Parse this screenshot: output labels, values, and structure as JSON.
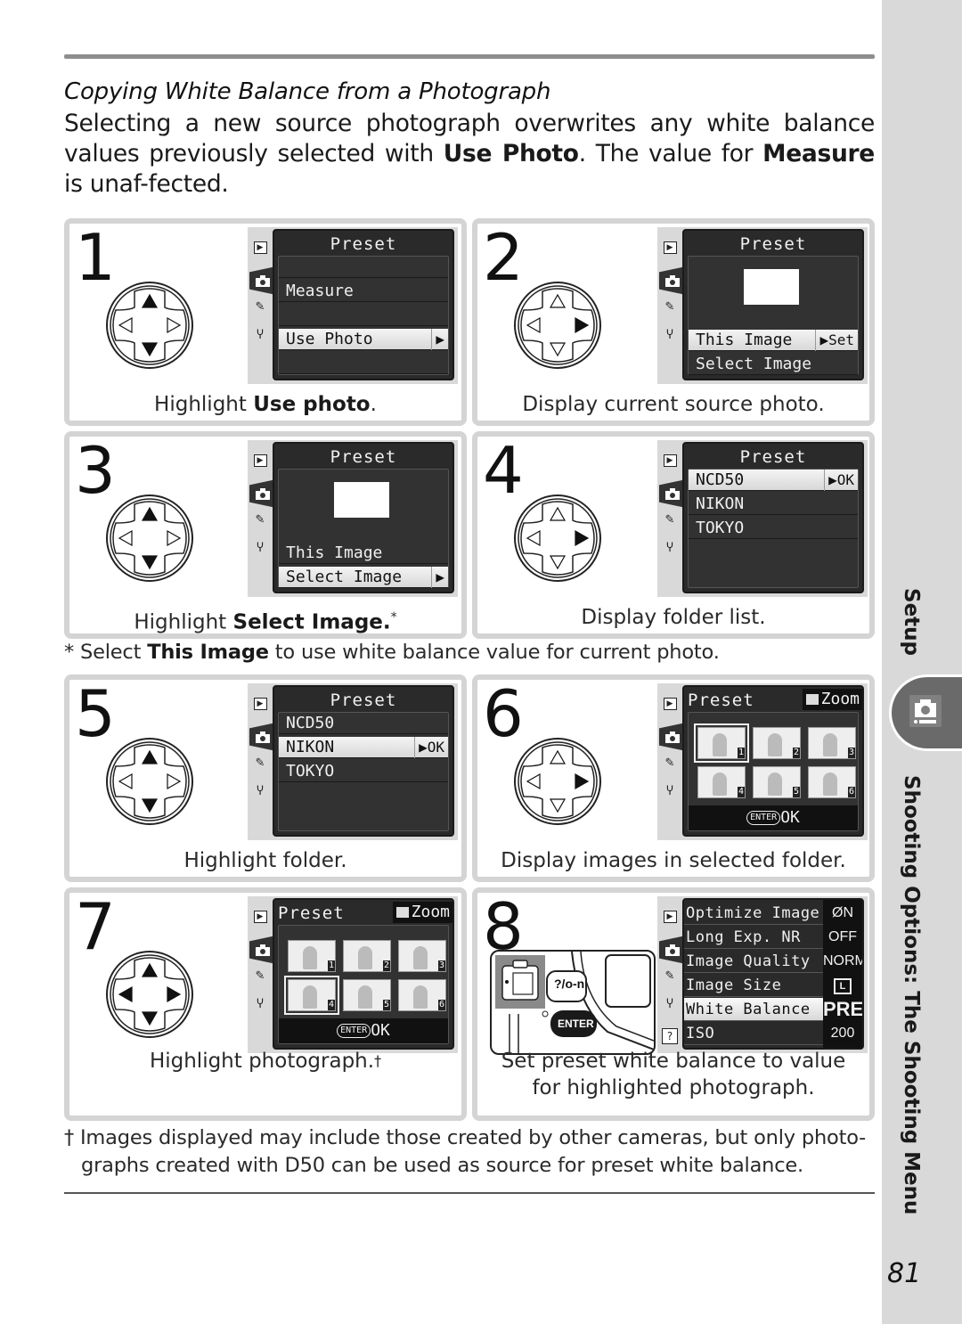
{
  "section": {
    "title": "Copying White Balance from a Photograph",
    "intro_parts": {
      "p1": "Selecting a new source photograph overwrites any white balance values previously selected with ",
      "b1": "Use Photo",
      "p2": ".  The value for ",
      "b2": "Measure",
      "p3": " is unaf-fected."
    }
  },
  "lcd_common": {
    "title": "Preset",
    "zoom_label": "Zoom",
    "enter_label": "ENTER",
    "ok_label": "OK",
    "play_tab": "▶",
    "pencil_tab": "✎",
    "wrench_tab": "Ⴤ",
    "help_tab": "?"
  },
  "steps": [
    {
      "number": "1",
      "caption_pre": "Highlight ",
      "caption_bold": "Use photo",
      "caption_post": ".",
      "dpad": "up-down",
      "lcd": {
        "rows": [
          "",
          "Measure",
          "",
          "Use Photo",
          ""
        ],
        "selected": "Use Photo",
        "arrow": "▶"
      }
    },
    {
      "number": "2",
      "caption_pre": "Display current source photo.",
      "caption_bold": "",
      "caption_post": "",
      "dpad": "right",
      "lcd": {
        "rows": [
          "This Image",
          "Select Image"
        ],
        "selected": "This Image",
        "arrow": "▶Set"
      }
    },
    {
      "number": "3",
      "caption_pre": "Highlight ",
      "caption_bold": "Select Image",
      "caption_post": ".*",
      "dpad": "up-down",
      "lcd": {
        "rows": [
          "This Image",
          "Select Image"
        ],
        "selected": "Select Image",
        "arrow": "▶"
      }
    },
    {
      "number": "4",
      "caption_pre": "Display folder list.",
      "caption_bold": "",
      "caption_post": "",
      "dpad": "right",
      "lcd": {
        "rows": [
          "NCD50",
          "NIKON",
          "TOKYO"
        ],
        "selected": "NCD50",
        "arrow": "▶OK"
      }
    },
    {
      "number": "5",
      "caption_pre": "Highlight folder.",
      "caption_bold": "",
      "caption_post": "",
      "dpad": "up-down",
      "lcd": {
        "rows": [
          "NCD50",
          "NIKON",
          "TOKYO"
        ],
        "selected": "NIKON",
        "arrow": "▶OK"
      }
    },
    {
      "number": "6",
      "caption_pre": "Display images in selected folder.",
      "caption_bold": "",
      "caption_post": "",
      "dpad": "right",
      "lcd": {
        "thumbnails": [
          "1",
          "2",
          "3",
          "4",
          "5",
          "6"
        ],
        "selected": "1"
      }
    },
    {
      "number": "7",
      "caption_pre": "Highlight photograph.",
      "caption_bold": "",
      "caption_post": "†",
      "dpad": "all",
      "lcd": {
        "thumbnails": [
          "1",
          "2",
          "3",
          "4",
          "5",
          "6"
        ],
        "selected": "4"
      }
    },
    {
      "number": "8",
      "caption_line1": "Set preset white balance to value",
      "caption_line2": "for highlighted photograph.",
      "camera_buttons": {
        "protect": "?/o-n",
        "enter": "ENTER"
      },
      "lcd": {
        "menu": [
          {
            "label": "Optimize Image",
            "value": "ØN"
          },
          {
            "label": "Long Exp. NR",
            "value": "OFF"
          },
          {
            "label": "Image Quality",
            "value": "NORM"
          },
          {
            "label": "Image Size",
            "value": "L"
          },
          {
            "label": "White Balance",
            "value": "PRE"
          },
          {
            "label": "ISO",
            "value": "200"
          }
        ],
        "selected": "White Balance"
      }
    }
  ],
  "footnotes": {
    "asterisk": {
      "mark": "*",
      "pre": " Select ",
      "bold": "This Image",
      "post": " to use white balance value for current photo."
    },
    "dagger": {
      "mark": "†",
      "line1": "Images displayed may include those created by other cameras, but only photo-",
      "line2": "graphs created with D50 can be used as source for preset white balance."
    }
  },
  "side": {
    "tab_setup": "Setup",
    "chapter": "Shooting Options: The Shooting Menu",
    "page_number": "81"
  },
  "colors": {
    "panel_border": "#d4d4d4",
    "side_strip": "#d9d9d9",
    "side_tab": "#6a6a6a",
    "lcd_bg": "#2a2a2a"
  }
}
